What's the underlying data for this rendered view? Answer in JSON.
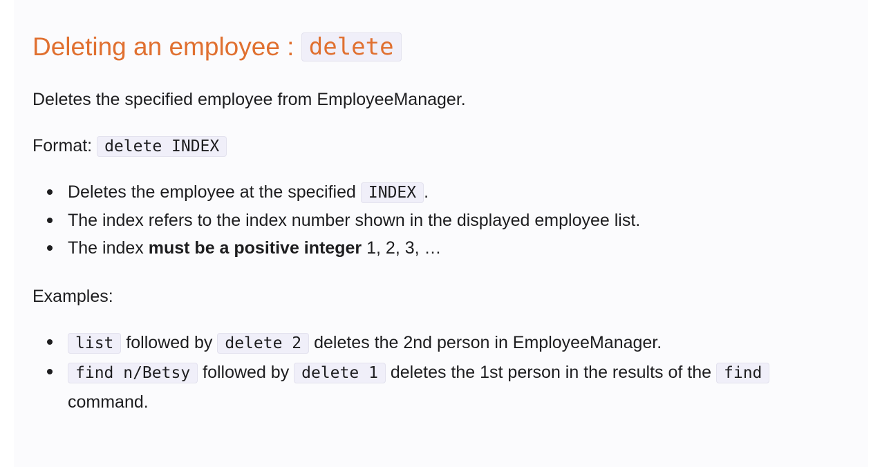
{
  "heading": {
    "text": "Deleting an employee : ",
    "command": "delete"
  },
  "description": "Deletes the specified employee from EmployeeManager.",
  "format": {
    "label": "Format: ",
    "code": "delete INDEX"
  },
  "notes": [
    {
      "prefix": "Deletes the employee at the specified ",
      "code": "INDEX",
      "suffix": "."
    },
    {
      "text": "The index refers to the index number shown in the displayed employee list."
    },
    {
      "prefix": "The index ",
      "bold": "must be a positive integer",
      "suffix": " 1, 2, 3, …"
    }
  ],
  "examples_label": "Examples:",
  "examples": [
    {
      "code1": "list",
      "mid": " followed by ",
      "code2": "delete 2",
      "suffix": " deletes the 2nd person in EmployeeManager."
    },
    {
      "code1": "find n/Betsy",
      "mid": " followed by ",
      "code2": "delete 1",
      "suffix": " deletes the 1st person in the results of the ",
      "code3": "find",
      "continuation": "command."
    }
  ]
}
